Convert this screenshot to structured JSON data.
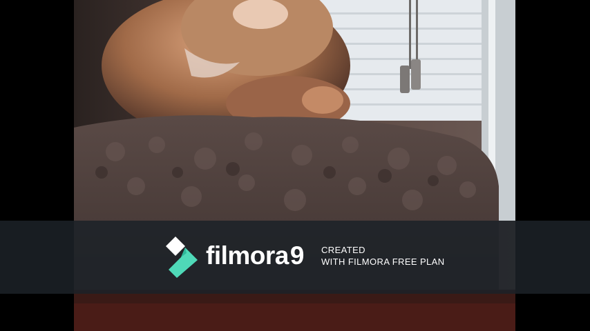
{
  "watermark": {
    "brand": "filmora",
    "version": "9",
    "line1": "CREATED",
    "line2": "WITH FILMORA FREE PLAN",
    "logo_icon": "filmora-diamond-logo-icon",
    "logo_colors": {
      "top": "#ffffff",
      "bottom": "#4fd9b8"
    },
    "background": "#1c2228"
  },
  "scene": {
    "subject": "cat-on-fuzzy-blanket",
    "colors": {
      "fur": "#b07a55",
      "blanket": "#4a3c38",
      "window": "#e8ecef",
      "bars": "#000000"
    }
  }
}
